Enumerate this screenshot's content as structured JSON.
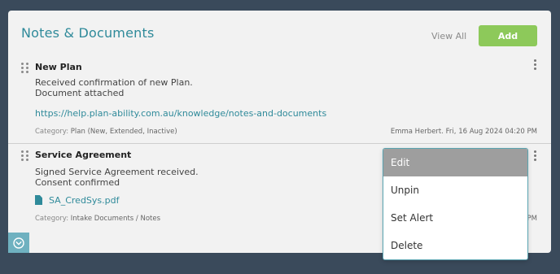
{
  "panel": {
    "title": "Notes & Documents",
    "view_all_label": "View All",
    "add_label": "Add"
  },
  "notes": [
    {
      "title": "New Plan",
      "body_lines": [
        "Received confirmation of new Plan.",
        "Document attached"
      ],
      "link": "https://help.plan-ability.com.au/knowledge/notes-and-documents",
      "category_label": "Category:",
      "category_value": "Plan (New, Extended, Inactive)",
      "author_date": "Emma Herbert. Fri, 16 Aug 2024 04:20 PM"
    },
    {
      "title": "Service Agreement",
      "body_lines": [
        "Signed Service Agreement received.",
        "Consent confirmed"
      ],
      "file_name": "SA_CredSys.pdf",
      "category_label": "Category:",
      "category_value": "Intake Documents / Notes",
      "author_date_fragment": "PM"
    }
  ],
  "context_menu": {
    "items": [
      "Edit",
      "Unpin",
      "Set Alert",
      "Delete"
    ],
    "active_index": 0
  },
  "icons": {
    "drag": "drag-handle-icon",
    "kebab": "kebab-menu-icon",
    "file": "file-icon",
    "collapse": "chevron-down-circle-icon"
  },
  "colors": {
    "background": "#3a4a5b",
    "card": "#f2f2f2",
    "accent": "#2f8a9a",
    "add_button": "#8dc95a",
    "menu_active": "#9e9e9e"
  }
}
